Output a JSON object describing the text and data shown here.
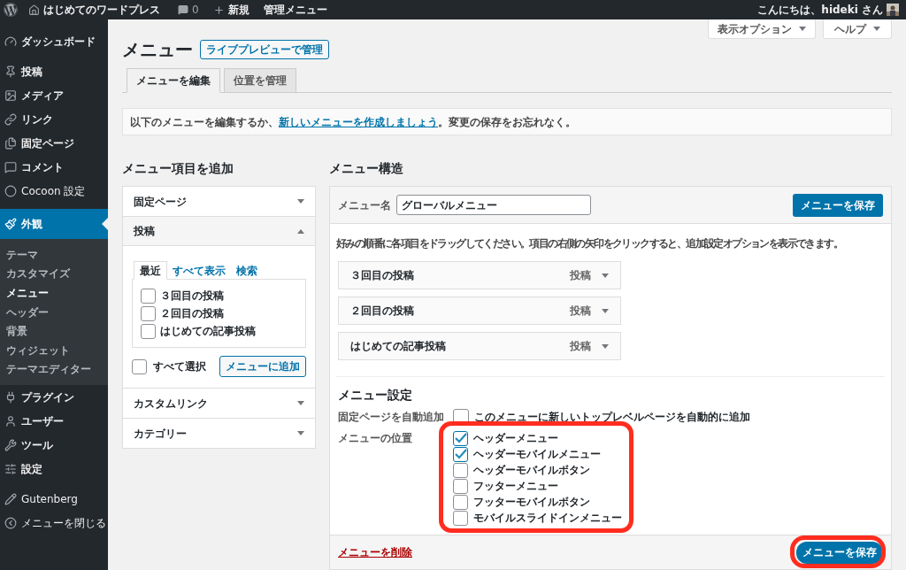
{
  "admin_bar": {
    "site_name": "はじめてのワードプレス",
    "comments_count": "0",
    "new_label": "新規",
    "admin_menu": "管理メニュー",
    "greeting": "こんにちは、hideki さん"
  },
  "sidebar": {
    "groups": [
      [
        {
          "label": "ダッシュボード",
          "selected": false
        }
      ],
      [
        {
          "label": "投稿",
          "selected": false
        },
        {
          "label": "メディア",
          "selected": false
        },
        {
          "label": "リンク",
          "selected": false
        },
        {
          "label": "固定ページ",
          "selected": false
        },
        {
          "label": "コメント",
          "selected": false
        },
        {
          "label": "Cocoon 設定",
          "selected": false
        }
      ],
      [
        {
          "label": "外観",
          "selected": true,
          "children": [
            {
              "label": "テーマ",
              "selected": false
            },
            {
              "label": "カスタマイズ",
              "selected": false
            },
            {
              "label": "メニュー",
              "selected": true
            },
            {
              "label": "ヘッダー",
              "selected": false
            },
            {
              "label": "背景",
              "selected": false
            },
            {
              "label": "ウィジェット",
              "selected": false
            },
            {
              "label": "テーマエディター",
              "selected": false
            }
          ]
        },
        {
          "label": "プラグイン",
          "selected": false
        },
        {
          "label": "ユーザー",
          "selected": false
        },
        {
          "label": "ツール",
          "selected": false
        },
        {
          "label": "設定",
          "selected": false
        }
      ],
      [
        {
          "label": "Gutenberg",
          "selected": false
        },
        {
          "label": "メニューを閉じる",
          "selected": false
        }
      ]
    ]
  },
  "page": {
    "title": "メニュー",
    "live_preview_button": "ライブプレビューで管理",
    "screen_options": "表示オプション",
    "help": "ヘルプ",
    "tabs": [
      {
        "label": "メニューを編集",
        "selected": true
      },
      {
        "label": "位置を管理",
        "selected": false
      }
    ],
    "notice": {
      "before": "以下のメニューを編集するか、",
      "link": "新しいメニューを作成しましょう",
      "after": "。変更の保存をお忘れなく。"
    }
  },
  "add_items": {
    "heading": "メニュー項目を追加",
    "sections": [
      {
        "title": "固定ページ",
        "expanded": false
      },
      {
        "title": "投稿",
        "expanded": true,
        "tabs": [
          {
            "label": "最近",
            "selected": true
          },
          {
            "label": "すべて表示",
            "selected": false
          },
          {
            "label": "検索",
            "selected": false
          }
        ],
        "items": [
          {
            "label": "３回目の投稿",
            "checked": false
          },
          {
            "label": "２回目の投稿",
            "checked": false
          },
          {
            "label": "はじめての記事投稿",
            "checked": false
          }
        ],
        "select_all": {
          "label": "すべて選択",
          "checked": false
        },
        "add_button": "メニューに追加"
      },
      {
        "title": "カスタムリンク",
        "expanded": false
      },
      {
        "title": "カテゴリー",
        "expanded": false
      }
    ]
  },
  "structure": {
    "heading": "メニュー構造",
    "menu_name_label": "メニュー名",
    "menu_name_value": "グローバルメニュー",
    "save_button": "メニューを保存",
    "instructions": "好みの順番に各項目をドラッグしてください。項目の右側の矢印をクリックすると、追加設定オプションを表示できます。",
    "items": [
      {
        "title": "３回目の投稿",
        "type": "投稿"
      },
      {
        "title": "２回目の投稿",
        "type": "投稿"
      },
      {
        "title": "はじめての記事投稿",
        "type": "投稿"
      }
    ],
    "settings_heading": "メニュー設定",
    "auto_add": {
      "label": "固定ページを自動追加",
      "option": "このメニューに新しいトップレベルページを自動的に追加",
      "checked": false
    },
    "locations": {
      "label": "メニューの位置",
      "options": [
        {
          "label": "ヘッダーメニュー",
          "checked": true
        },
        {
          "label": "ヘッダーモバイルメニュー",
          "checked": true
        },
        {
          "label": "ヘッダーモバイルボタン",
          "checked": false
        },
        {
          "label": "フッターメニュー",
          "checked": false
        },
        {
          "label": "フッターモバイルボタン",
          "checked": false
        },
        {
          "label": "モバイルスライドインメニュー",
          "checked": false
        }
      ]
    },
    "delete_link": "メニューを削除",
    "footer_save_button": "メニューを保存"
  }
}
